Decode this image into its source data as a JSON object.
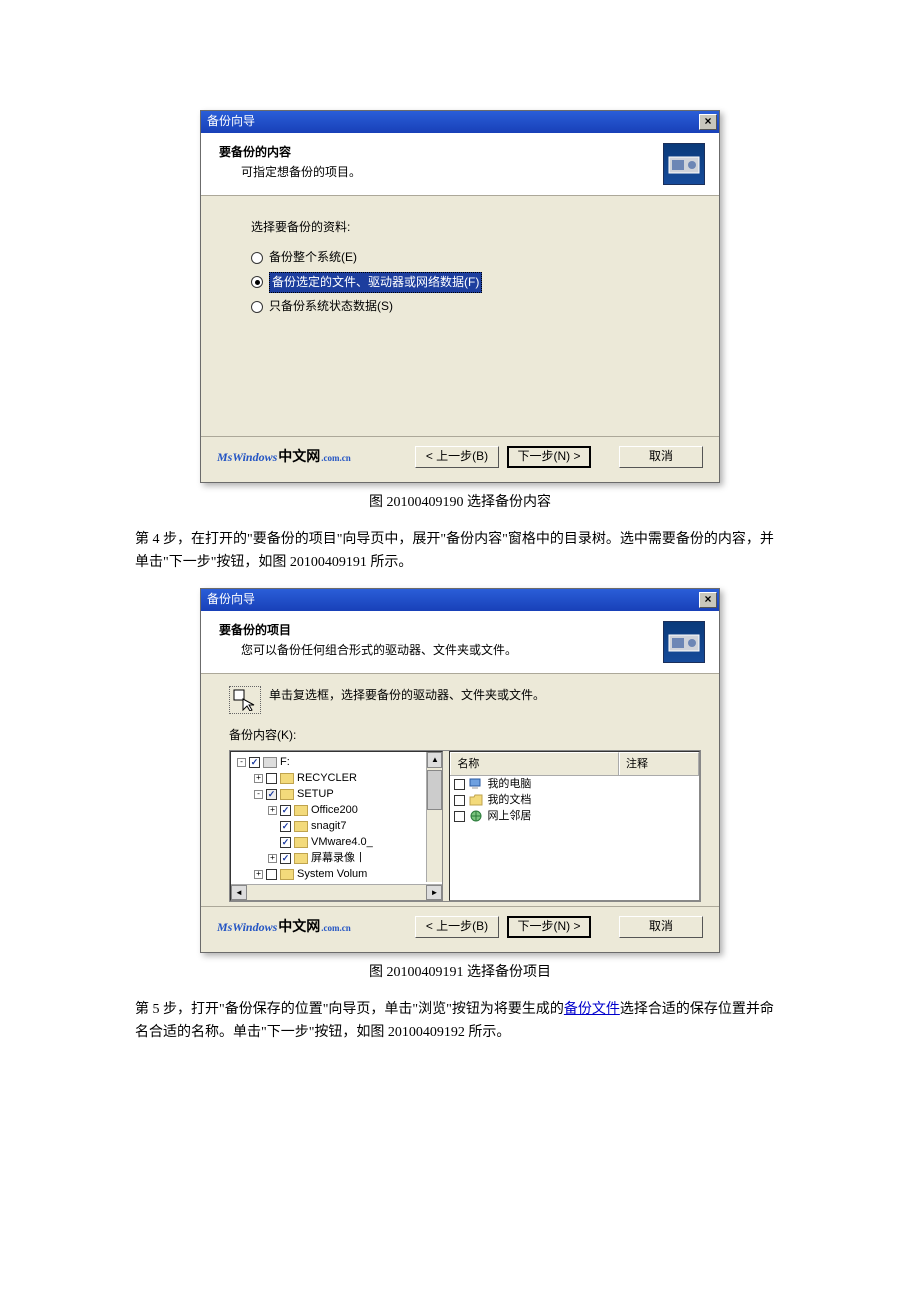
{
  "dialog1": {
    "title": "备份向导",
    "header_title": "要备份的内容",
    "header_sub": "可指定想备份的项目。",
    "prompt": "选择要备份的资料:",
    "opt1": "备份整个系统(E)",
    "opt2": "备份选定的文件、驱动器或网络数据(F)",
    "opt3": "只备份系统状态数据(S)",
    "back": "< 上一步(B)",
    "next": "下一步(N) >",
    "cancel": "取消",
    "wm_ms": "MsWindows",
    "wm_cn": "中文网",
    "wm_dom": ".com.cn"
  },
  "caption1": "图 20100409190  选择备份内容",
  "para1_a": "第 4 步，在打开的\"要备份的项目\"向导页中，展开\"备份内容\"窗格中的目录树。选中需要备份的内容，并单击\"下一步\"按钮，如图 20100409191 所示。",
  "dialog2": {
    "title": "备份向导",
    "header_title": "要备份的项目",
    "header_sub": "您可以备份任何组合形式的驱动器、文件夹或文件。",
    "instr": "单击复选框，选择要备份的驱动器、文件夹或文件。",
    "contents_label": "备份内容(K):",
    "tree": {
      "r0": "F:",
      "r1": "RECYCLER",
      "r2": "SETUP",
      "r3": "Office200",
      "r4": "snagit7",
      "r5": "VMware4.0_",
      "r6": "屏幕录像丨",
      "r7": "System Volum"
    },
    "list": {
      "col1": "名称",
      "col2": "注释",
      "item1": "我的电脑",
      "item2": "我的文档",
      "item3": "网上邻居"
    },
    "back": "< 上一步(B)",
    "next": "下一步(N) >",
    "cancel": "取消",
    "wm_ms": "MsWindows",
    "wm_cn": "中文网",
    "wm_dom": ".com.cn"
  },
  "caption2": "图 20100409191  选择备份项目",
  "para2_pre": "第 5 步，打开\"备份保存的位置\"向导页，单击\"浏览\"按钮为将要生成的",
  "para2_link": "备份文件",
  "para2_post": "选择合适的保存位置并命名合适的名称。单击\"下一步\"按钮，如图 20100409192 所示。"
}
